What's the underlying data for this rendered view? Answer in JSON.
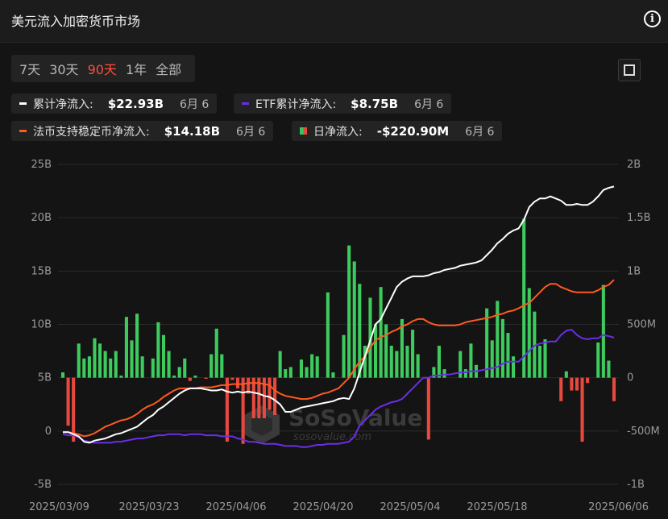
{
  "header": {
    "title": "美元流入加密货币市场"
  },
  "range_tabs": [
    {
      "label": "7天",
      "active": false
    },
    {
      "label": "30天",
      "active": false
    },
    {
      "label": "90天",
      "active": true
    },
    {
      "label": "1年",
      "active": false
    },
    {
      "label": "全部",
      "active": false
    }
  ],
  "legend": [
    {
      "label": "累计净流入:",
      "value": "$22.93B",
      "date": "6月 6",
      "color": "#ffffff"
    },
    {
      "label": "ETF累计净流入:",
      "value": "$8.75B",
      "date": "6月 6",
      "color": "#6a2ee8"
    },
    {
      "label": "法币支持稳定币净流入:",
      "value": "$14.18B",
      "date": "6月 6",
      "color": "#ff5a1f"
    },
    {
      "label": "日净流入:",
      "value": "-$220.90M",
      "date": "6月 6",
      "color": "#34c759"
    }
  ],
  "watermark": {
    "brand": "SoSoValue",
    "site": "sosovalue.com"
  },
  "colors": {
    "positive": "#3ecb5e",
    "negative": "#e8493f",
    "background": "#141414",
    "accent": "#ff4e3b"
  },
  "chart_data": {
    "type": "bar+line",
    "x_tick_labels": [
      "2025/03/09",
      "2025/03/23",
      "2025/04/06",
      "2025/04/20",
      "2025/05/04",
      "2025/05/18",
      "2025/06/06"
    ],
    "left_axis_ticks": [
      "-5B",
      "0",
      "5B",
      "10B",
      "15B",
      "20B",
      "25B"
    ],
    "right_axis_ticks": [
      "-1B",
      "-500M",
      "0",
      "500M",
      "1B",
      "1.5B",
      "2B"
    ],
    "left_ylim": [
      -5,
      25
    ],
    "right_ylim": [
      -1,
      2
    ],
    "grid": "horizontal",
    "bars_daily_net_inflow_B": [
      0.05,
      -0.45,
      -0.6,
      0.32,
      0.18,
      0.2,
      0.37,
      0.32,
      0.25,
      0.18,
      0.25,
      0.02,
      0.57,
      0.35,
      0.6,
      0.2,
      0.0,
      0.18,
      0.52,
      0.4,
      0.25,
      0.02,
      0.1,
      0.18,
      -0.03,
      0.02,
      0.0,
      -0.01,
      0.22,
      0.46,
      0.22,
      -0.6,
      -0.02,
      -0.1,
      -0.62,
      -0.15,
      -0.38,
      -0.38,
      -0.38,
      -0.3,
      -0.35,
      0.25,
      0.08,
      0.1,
      0.0,
      0.17,
      0.1,
      0.22,
      0.2,
      0.0,
      0.8,
      0.05,
      0.0,
      0.4,
      1.24,
      1.09,
      0.88,
      0.3,
      0.75,
      0.5,
      0.85,
      0.5,
      0.3,
      0.25,
      0.55,
      0.3,
      0.45,
      0.22,
      0.0,
      -0.58,
      0.1,
      0.3,
      0.08,
      0.0,
      0.0,
      0.25,
      0.08,
      0.32,
      0.12,
      0.0,
      0.65,
      0.35,
      0.72,
      0.55,
      0.42,
      0.2,
      0.0,
      1.49,
      0.84,
      0.62,
      0.3,
      0.36,
      0.0,
      0.0,
      -0.22,
      0.06,
      -0.12,
      -0.12,
      -0.6,
      -0.05,
      0.0,
      0.33,
      0.87,
      0.16,
      -0.22
    ],
    "series": [
      {
        "name": "累计净流入",
        "axis": "left",
        "values": [
          -0.1,
          -0.1,
          -0.3,
          -0.5,
          -1.0,
          -1.1,
          -0.9,
          -0.8,
          -0.7,
          -0.5,
          -0.3,
          -0.2,
          0.0,
          0.2,
          0.4,
          0.8,
          1.2,
          1.5,
          2.0,
          2.3,
          2.7,
          3.1,
          3.5,
          3.8,
          4.0,
          4.0,
          4.0,
          3.9,
          3.8,
          3.8,
          3.9,
          3.7,
          3.6,
          3.7,
          3.6,
          3.7,
          3.6,
          3.5,
          3.3,
          3.2,
          2.9,
          2.5,
          1.8,
          1.8,
          2.0,
          2.2,
          2.3,
          2.4,
          2.5,
          2.6,
          2.7,
          2.8,
          3.0,
          3.1,
          3.0,
          4.0,
          5.5,
          7.0,
          8.5,
          10.0,
          10.5,
          11.5,
          12.5,
          13.5,
          14.0,
          14.3,
          14.5,
          14.5,
          14.5,
          14.6,
          14.8,
          14.9,
          15.1,
          15.2,
          15.3,
          15.5,
          15.6,
          15.7,
          15.8,
          16.0,
          16.5,
          17.0,
          17.6,
          18.0,
          18.5,
          18.8,
          19.0,
          19.8,
          21.0,
          21.5,
          21.8,
          21.8,
          22.0,
          21.8,
          21.6,
          21.2,
          21.2,
          21.3,
          21.2,
          21.2,
          21.5,
          22.0,
          22.6,
          22.8,
          22.93
        ]
      },
      {
        "name": "ETF累计净流入",
        "axis": "left",
        "values": [
          -0.3,
          -0.4,
          -0.4,
          -0.6,
          -0.9,
          -1.0,
          -1.1,
          -1.1,
          -1.1,
          -1.1,
          -1.0,
          -1.0,
          -0.9,
          -0.8,
          -0.7,
          -0.7,
          -0.6,
          -0.5,
          -0.4,
          -0.4,
          -0.3,
          -0.3,
          -0.3,
          -0.4,
          -0.3,
          -0.3,
          -0.3,
          -0.4,
          -0.4,
          -0.4,
          -0.5,
          -0.5,
          -0.5,
          -0.7,
          -0.8,
          -1.0,
          -1.0,
          -1.1,
          -1.2,
          -1.2,
          -1.2,
          -1.3,
          -1.4,
          -1.4,
          -1.4,
          -1.5,
          -1.5,
          -1.4,
          -1.3,
          -1.3,
          -1.2,
          -1.2,
          -1.2,
          -1.1,
          -1.0,
          -0.5,
          0.5,
          1.0,
          1.5,
          2.0,
          2.3,
          2.5,
          2.7,
          2.8,
          3.0,
          3.5,
          4.0,
          4.5,
          5.0,
          5.0,
          5.2,
          5.2,
          5.3,
          5.3,
          5.4,
          5.5,
          5.5,
          5.6,
          5.6,
          5.7,
          5.8,
          5.9,
          6.0,
          6.3,
          6.5,
          6.5,
          6.5,
          7.0,
          7.5,
          8.0,
          8.2,
          8.3,
          8.4,
          8.4,
          9.0,
          9.4,
          9.5,
          9.0,
          8.7,
          8.6,
          8.7,
          8.7,
          9.0,
          8.9,
          8.75
        ]
      },
      {
        "name": "法币支持稳定币净流入",
        "axis": "left",
        "values": [
          -0.1,
          -0.1,
          -0.2,
          -0.3,
          -0.5,
          -0.4,
          -0.2,
          0.1,
          0.4,
          0.6,
          0.8,
          1.0,
          1.1,
          1.3,
          1.6,
          2.0,
          2.3,
          2.5,
          2.8,
          3.2,
          3.5,
          3.8,
          4.0,
          4.0,
          4.0,
          4.0,
          4.1,
          4.1,
          4.1,
          4.2,
          4.3,
          4.3,
          4.4,
          4.4,
          4.4,
          4.5,
          4.5,
          4.5,
          4.4,
          4.3,
          3.8,
          3.5,
          3.3,
          3.2,
          3.1,
          3.0,
          3.0,
          3.1,
          3.3,
          3.5,
          3.6,
          3.8,
          4.0,
          4.5,
          5.0,
          5.8,
          6.5,
          7.0,
          7.8,
          8.5,
          8.8,
          9.0,
          9.3,
          9.5,
          9.8,
          10.0,
          10.3,
          10.5,
          10.5,
          10.2,
          10.0,
          9.9,
          9.9,
          9.9,
          9.9,
          10.0,
          10.2,
          10.3,
          10.4,
          10.5,
          10.6,
          10.7,
          10.9,
          11.0,
          11.2,
          11.3,
          11.5,
          11.8,
          12.0,
          12.5,
          13.0,
          13.5,
          13.8,
          13.8,
          13.5,
          13.3,
          13.1,
          13.0,
          13.0,
          13.0,
          13.0,
          13.2,
          13.5,
          13.7,
          14.18
        ]
      }
    ]
  }
}
